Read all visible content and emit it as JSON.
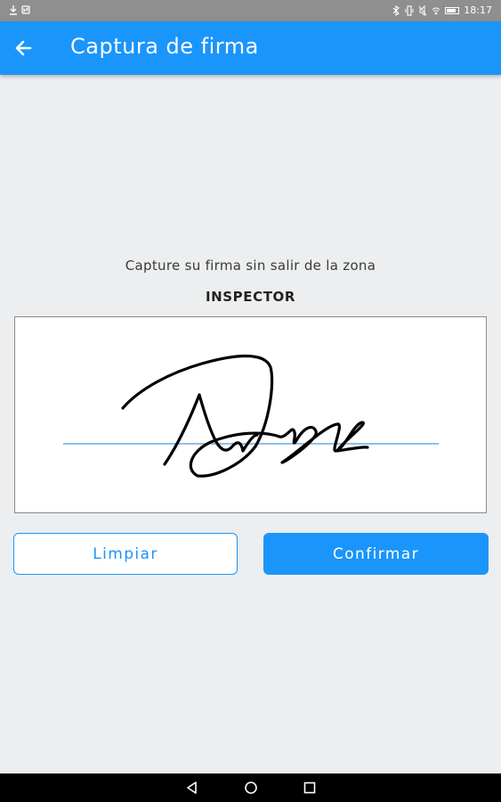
{
  "status_bar": {
    "time": "18:17",
    "left_icons": [
      "download-icon",
      "nfc-icon"
    ],
    "right_icons": [
      "bluetooth-icon",
      "vibrate-icon",
      "mute-icon",
      "wifi-icon",
      "battery-icon"
    ]
  },
  "app_bar": {
    "title": "Captura de firma",
    "back_icon": "arrow-left-icon",
    "color": "#1a95fb"
  },
  "signature": {
    "instruction": "Capture su firma sin salir de la zona",
    "role": "INSPECTOR",
    "baseline_color": "#8fbfe8",
    "stroke_color": "#000000"
  },
  "actions": {
    "clear_label": "Limpiar",
    "confirm_label": "Confirmar",
    "accent_color": "#1a95fb"
  },
  "nav_bar": {
    "items": [
      "back-triangle-icon",
      "home-circle-icon",
      "recents-square-icon"
    ]
  }
}
